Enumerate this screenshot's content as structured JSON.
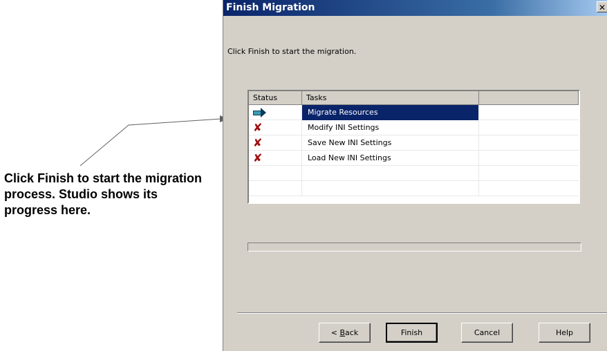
{
  "callout": {
    "text": "Click Finish to start the migration process. Studio shows its progress here."
  },
  "dialog": {
    "title": "Finish Migration",
    "close_glyph": "✕",
    "intro": "Click Finish to start the migration.",
    "columns": [
      "Status",
      "Tasks",
      ""
    ],
    "tasks": [
      {
        "status": "in-progress-arrow-icon",
        "label": "Migrate Resources",
        "selected": true
      },
      {
        "status": "red-x-icon",
        "label": "Modify INI Settings",
        "selected": false
      },
      {
        "status": "red-x-icon",
        "label": "Save New INI Settings",
        "selected": false
      },
      {
        "status": "red-x-icon",
        "label": "Load New INI Settings",
        "selected": false
      }
    ],
    "progress_percent": 0,
    "buttons": {
      "back_prefix": "< ",
      "back_mnemonic": "B",
      "back_rest": "ack",
      "finish": "Finish",
      "cancel": "Cancel",
      "help": "Help"
    }
  },
  "colors": {
    "title_bar": "#0a246a",
    "selection": "#0a246a",
    "x_mark": "#a01010",
    "arrow": "#3a9bb5"
  }
}
